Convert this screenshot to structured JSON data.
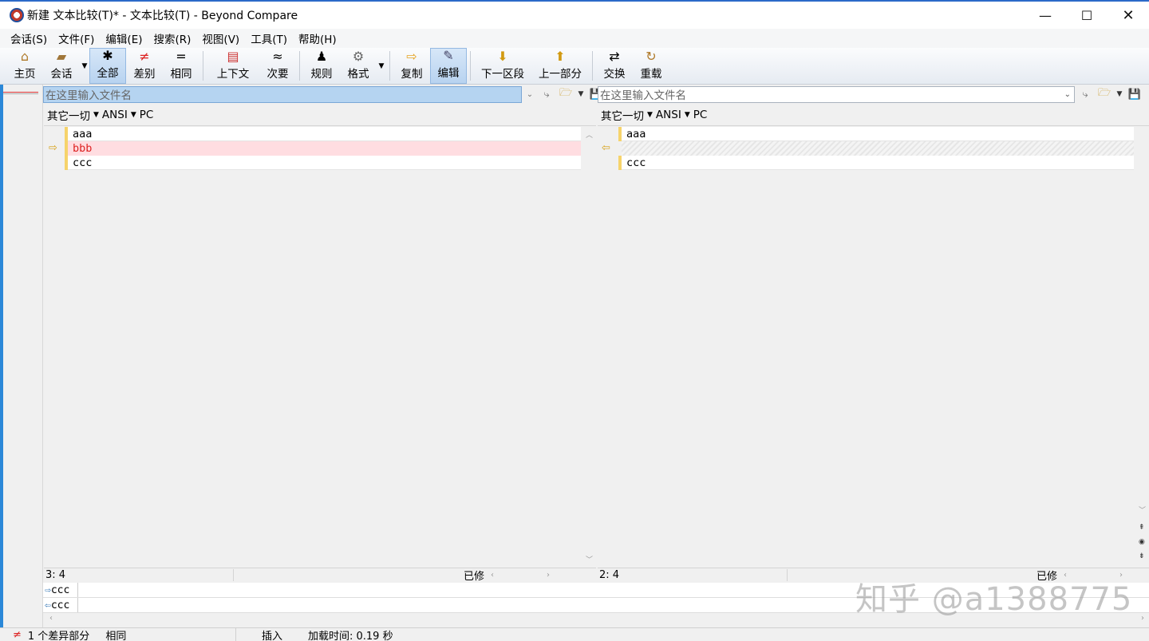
{
  "window": {
    "title": "新建 文本比较(T)* - 文本比较(T) - Beyond Compare"
  },
  "menu": [
    "会话(S)",
    "文件(F)",
    "编辑(E)",
    "搜索(R)",
    "视图(V)",
    "工具(T)",
    "帮助(H)"
  ],
  "toolbar": {
    "home": "主页",
    "session": "会话",
    "all": "全部",
    "diffs": "差别",
    "same": "相同",
    "context": "上下文",
    "minor": "次要",
    "rules": "规则",
    "format": "格式",
    "copy": "复制",
    "edit": "编辑",
    "next_section": "下一区段",
    "prev_part": "上一部分",
    "swap": "交换",
    "reload": "重载"
  },
  "left": {
    "path_placeholder": "在这里输入文件名",
    "info": {
      "enc1": "其它一切",
      "enc2": "ANSI",
      "enc3": "PC"
    },
    "lines": [
      "aaa",
      "bbb",
      "ccc"
    ],
    "position": "3: 4",
    "modified": "已修"
  },
  "right": {
    "path_placeholder": "在这里输入文件名",
    "info": {
      "enc1": "其它一切",
      "enc2": "ANSI",
      "enc3": "PC"
    },
    "lines": [
      "aaa",
      "",
      "ccc"
    ],
    "position": "2: 4",
    "modified": "已修"
  },
  "detail": {
    "line1": "ccc",
    "line2": "ccc"
  },
  "status": {
    "diff_count": "1 个差异部分",
    "same": "相同",
    "insert": "插入",
    "load_time": "加载时间:  0.19 秒"
  },
  "watermark": "知乎 @a1388775",
  "colors": {
    "diff_bg": "#ffdde1",
    "diff_text": "#dd2222",
    "accent": "#2b6ac9"
  }
}
